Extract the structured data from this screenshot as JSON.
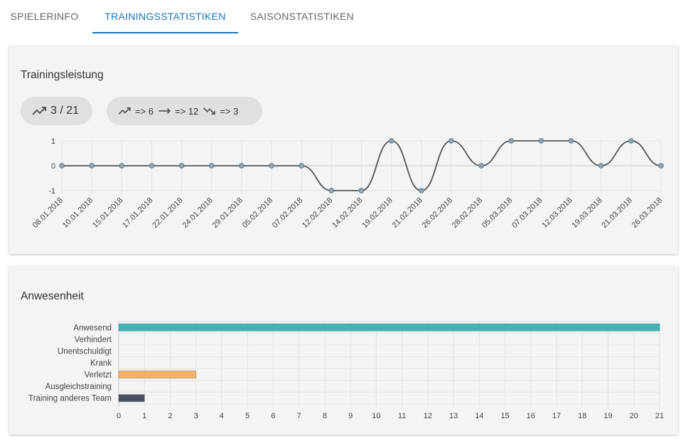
{
  "tabs": [
    {
      "label": "SPIELERINFO",
      "active": false
    },
    {
      "label": "TRAININGSSTATISTIKEN",
      "active": true
    },
    {
      "label": "SAISONSTATISTIKEN",
      "active": false
    }
  ],
  "colors": {
    "accent": "#1a73b8",
    "card_bg": "#f4f4f4",
    "line": "#555555",
    "point": "#8fa7b8",
    "bar_anwesend": "#3fb5b2",
    "bar_verletzt": "#f1b262",
    "bar_training_anderes_team": "#4a5060"
  },
  "performance_card": {
    "title": "Trainingsleistung",
    "total_chip": {
      "icon": "trending-up-icon",
      "text": "3 / 21"
    },
    "trend_chip": [
      {
        "icon": "trending-up-icon",
        "text": "=> 6"
      },
      {
        "icon": "trending-flat-icon",
        "text": "=> 12"
      },
      {
        "icon": "trending-down-icon",
        "text": "=> 3"
      }
    ]
  },
  "attendance_card": {
    "title": "Anwesenheit"
  },
  "chart_data": [
    {
      "type": "line",
      "categories": [
        "08.01.2018",
        "10.01.2018",
        "15.01.2018",
        "17.01.2018",
        "22.01.2018",
        "24.01.2018",
        "29.01.2018",
        "05.02.2018",
        "07.02.2018",
        "12.02.2018",
        "14.02.2018",
        "19.02.2018",
        "21.02.2018",
        "26.02.2018",
        "28.02.2018",
        "05.03.2018",
        "07.03.2018",
        "12.03.2018",
        "19.03.2018",
        "21.03.2018",
        "26.03.2018"
      ],
      "values": [
        0,
        0,
        0,
        0,
        0,
        0,
        0,
        0,
        0,
        -1,
        -1,
        1,
        -1,
        1,
        0,
        1,
        1,
        1,
        0,
        1,
        0
      ],
      "yticks": [
        1,
        0,
        -1
      ],
      "ylim": [
        -1,
        1
      ],
      "grid": true
    },
    {
      "type": "bar",
      "orientation": "horizontal",
      "categories": [
        "Anwesend",
        "Verhindert",
        "Unentschuldigt",
        "Krank",
        "Verletzt",
        "Ausgleichstraining",
        "Training anderes Team"
      ],
      "values": [
        21,
        0,
        0,
        0,
        3,
        0,
        1
      ],
      "xticks": [
        0,
        1,
        2,
        3,
        4,
        5,
        6,
        7,
        8,
        9,
        10,
        11,
        12,
        13,
        14,
        15,
        16,
        17,
        18,
        19,
        20,
        21
      ],
      "xlim": [
        0,
        21
      ],
      "grid": true
    }
  ]
}
